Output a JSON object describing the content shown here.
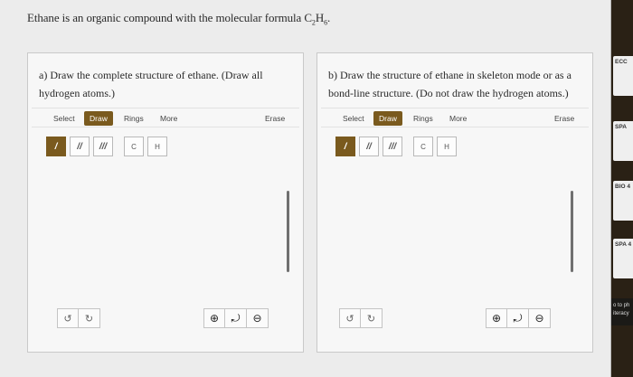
{
  "question": {
    "intro": "Ethane is an organic compound with the molecular formula C",
    "sub1": "2",
    "mid": "H",
    "sub2": "6",
    "end": "."
  },
  "panels": {
    "a": {
      "prompt": "a) Draw the complete structure of ethane. (Draw all hydrogen atoms.)",
      "toolbar": {
        "select": "Select",
        "draw": "Draw",
        "rings": "Rings",
        "more": "More",
        "erase": "Erase"
      },
      "bonds": {
        "single": "/",
        "double": "//",
        "triple": "///"
      },
      "atoms": {
        "c": "C",
        "h": "H"
      }
    },
    "b": {
      "prompt": "b) Draw the structure of ethane in skeleton mode or as a bond-line structure. (Do not draw the hydrogen atoms.)",
      "toolbar": {
        "select": "Select",
        "draw": "Draw",
        "rings": "Rings",
        "more": "More",
        "erase": "Erase"
      },
      "bonds": {
        "single": "/",
        "double": "//",
        "triple": "///"
      },
      "atoms": {
        "c": "C",
        "h": "H"
      }
    }
  },
  "icons": {
    "undo": "undo-icon",
    "redo": "redo-icon",
    "zoom_in": "zoom-in-icon",
    "reset": "reset-zoom-icon",
    "zoom_out": "zoom-out-icon"
  },
  "side": {
    "c1": "ECC",
    "c2": "SPA",
    "c3": "BIO 4",
    "c4": "SPA 4",
    "c5a": "o to ph",
    "c5b": "iteracy"
  },
  "colors": {
    "accent": "#7a5a1e",
    "page": "#ececec",
    "panel": "#f7f7f7"
  }
}
